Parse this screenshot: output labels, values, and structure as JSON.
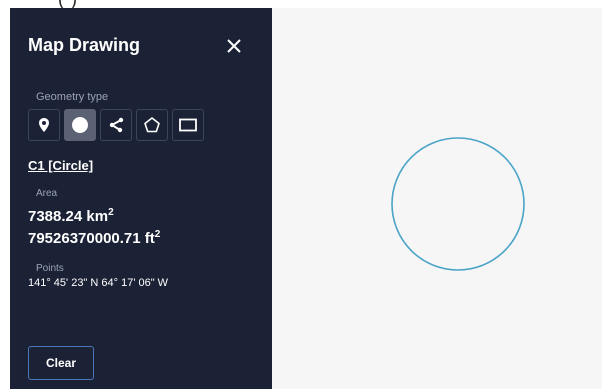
{
  "header_crop": {
    "text": "(    )"
  },
  "panel": {
    "title": "Map Drawing",
    "close_icon": "close-icon",
    "geometry_type_label": "Geometry type",
    "geometry_types": [
      {
        "name": "point",
        "icon": "map-pin-icon",
        "active": false
      },
      {
        "name": "circle",
        "icon": "circle-icon",
        "active": true
      },
      {
        "name": "line",
        "icon": "polyline-icon",
        "active": false
      },
      {
        "name": "polygon",
        "icon": "pentagon-icon",
        "active": false
      },
      {
        "name": "rectangle",
        "icon": "rectangle-icon",
        "active": false
      }
    ],
    "feature_name": "C1 [Circle]",
    "area_label": "Area",
    "area_km_value": "7388.24 km",
    "area_km_exp": "2",
    "area_ft_value": "79526370000.71 ft",
    "area_ft_exp": "2",
    "points_label": "Points",
    "points_value": "141° 45' 23\" N 64° 17' 06\" W",
    "clear_label": "Clear"
  },
  "map": {
    "shape": "circle",
    "stroke_color": "#4aa3c8",
    "background": "#f6f6f6"
  },
  "colors": {
    "panel_bg": "#1c2235",
    "active_button": "#5b6274",
    "clear_border": "#4a78b5"
  }
}
